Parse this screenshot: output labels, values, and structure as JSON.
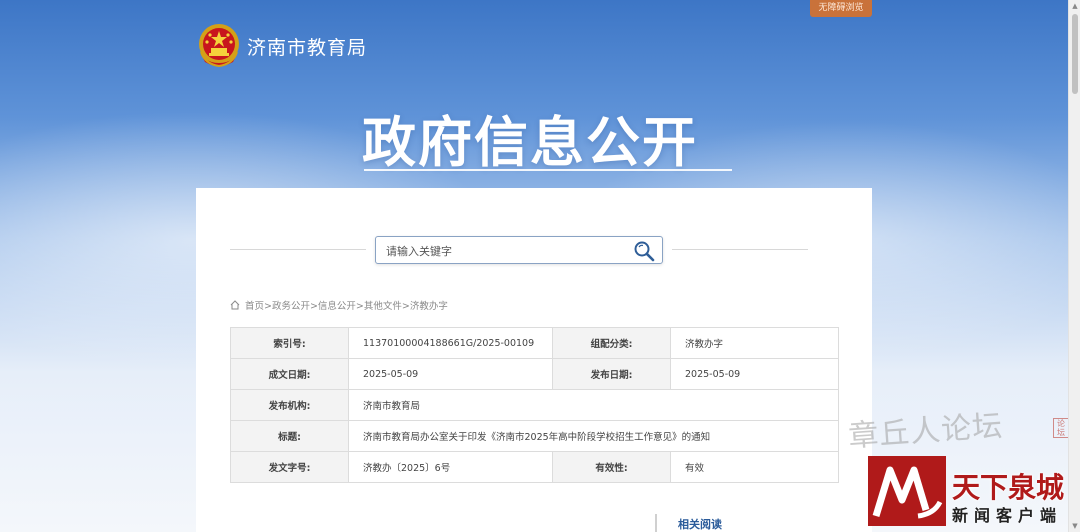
{
  "header": {
    "access_button": "无障碍浏览",
    "site_name": "济南市教育局",
    "hero_title": "政府信息公开"
  },
  "search": {
    "placeholder": "请输入关键字"
  },
  "breadcrumb": "首页>政务公开>信息公开>其他文件>济教办字",
  "meta": {
    "index_label": "索引号:",
    "index_value": "11370100004188661G/2025-00109",
    "category_label": "组配分类:",
    "category_value": "济教办字",
    "created_label": "成文日期:",
    "created_value": "2025-05-09",
    "published_label": "发布日期:",
    "published_value": "2025-05-09",
    "org_label": "发布机构:",
    "org_value": "济南市教育局",
    "title_label": "标题:",
    "title_value": "济南市教育局办公室关于印发《济南市2025年高中阶段学校招生工作意见》的通知",
    "docno_label": "发文字号:",
    "docno_value": "济教办〔2025〕6号",
    "validity_label": "有效性:",
    "validity_value": "有效"
  },
  "related": "相关阅读",
  "watermark": {
    "forum": "章丘人论坛",
    "seal": "论坛",
    "brand": "天下泉城",
    "sub": "新闻客户端"
  },
  "colors": {
    "accent": "#3d76c6",
    "access_button": "#c9723a",
    "brand_red": "#b01a1a",
    "link": "#2a5b9a"
  },
  "icons": {
    "emblem": "national-emblem-icon",
    "search": "magnifier-icon",
    "home": "home-icon",
    "watermark_logo": "tianxia-quancheng-logo-icon"
  }
}
